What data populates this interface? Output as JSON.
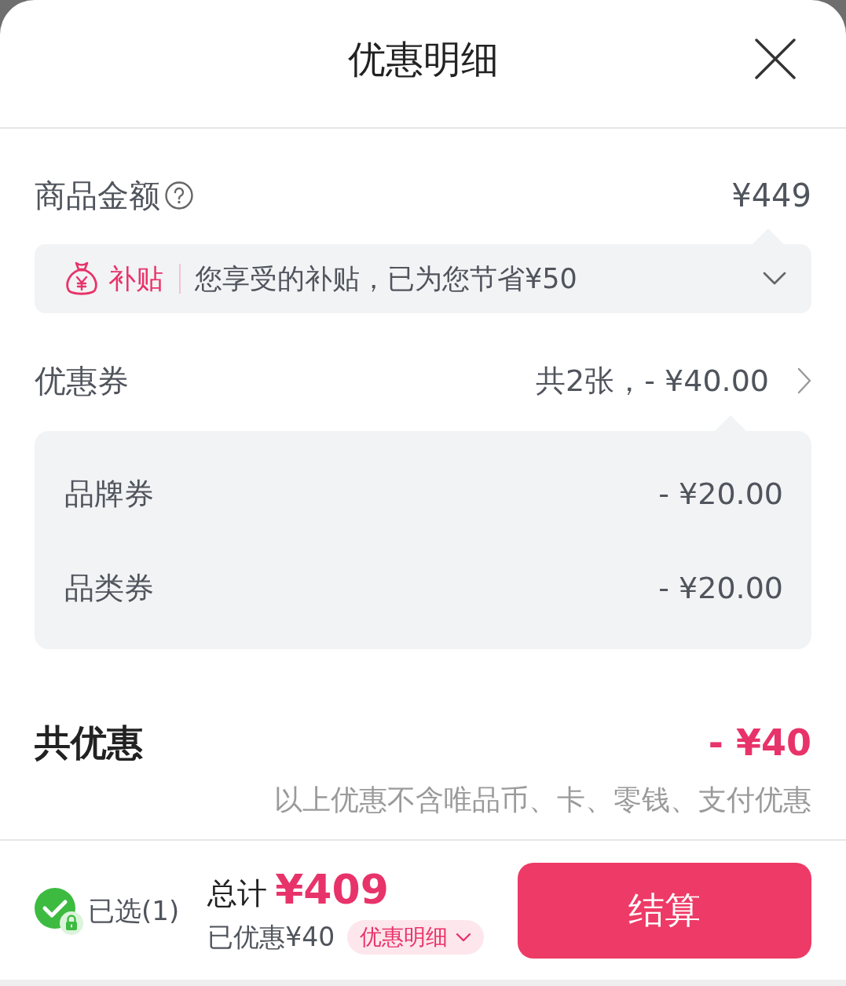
{
  "sheet": {
    "title": "优惠明细"
  },
  "goods_amount": {
    "label": "商品金额",
    "value": "¥449"
  },
  "subsidy": {
    "tag": "补贴",
    "text": "您享受的补贴，已为您节省¥50",
    "expanded": false
  },
  "coupons": {
    "label": "优惠券",
    "summary": "共2张，- ¥40.00",
    "items": [
      {
        "name": "品牌券",
        "amount": "- ¥20.00"
      },
      {
        "name": "品类券",
        "amount": "- ¥20.00"
      }
    ]
  },
  "total_discount": {
    "label": "共优惠",
    "value": "- ¥40",
    "note": "以上优惠不含唯品币、卡、零钱、支付优惠"
  },
  "footer": {
    "selection": {
      "checked": true,
      "label": "已选(1)"
    },
    "total": {
      "label": "总计",
      "value": "¥409"
    },
    "saved": "已优惠¥40",
    "details_button": "优惠明细",
    "checkout_button": "结算"
  }
}
